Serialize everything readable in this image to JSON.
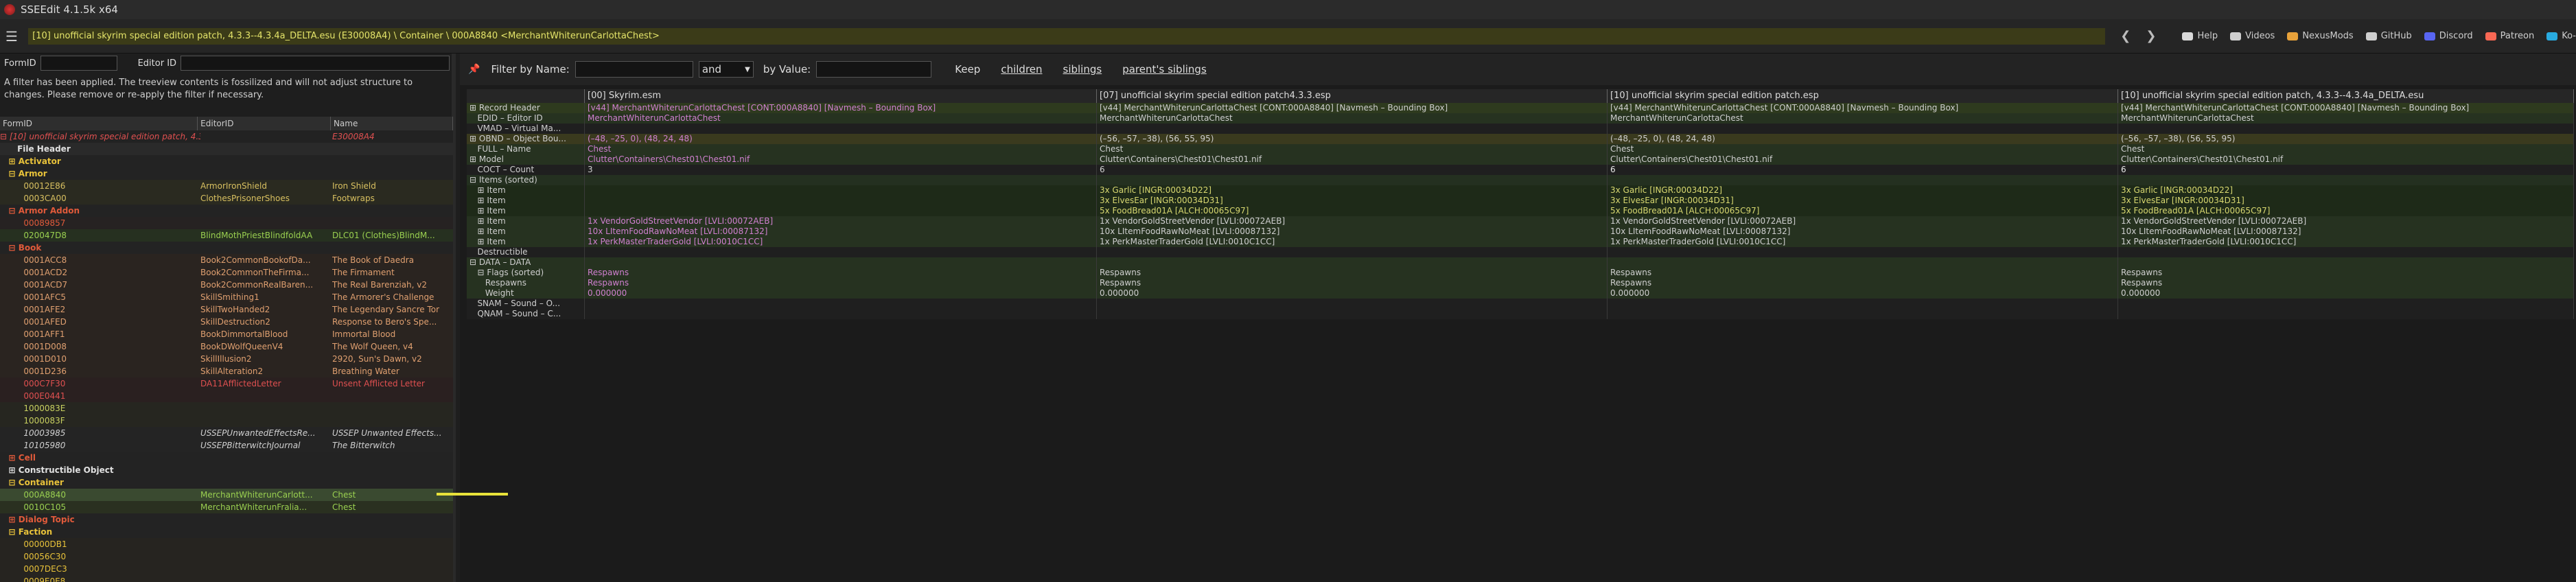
{
  "titlebar": {
    "title": "SSEEdit 4.1.5k x64"
  },
  "navbar": {
    "path": "[10] unofficial skyrim special edition patch, 4.3.3--4.3.4a_DELTA.esu (E30008A4) \\ Container \\ 000A8840 <MerchantWhiterunCarlottaChest>",
    "back": "❮",
    "forward": "❯",
    "links": [
      {
        "label": "Help",
        "color": "#d9d9d9"
      },
      {
        "label": "Videos",
        "color": "#cfcfcf"
      },
      {
        "label": "NexusMods",
        "color": "#e8a23a"
      },
      {
        "label": "GitHub",
        "color": "#cfcfcf"
      },
      {
        "label": "Discord",
        "color": "#5865f2"
      },
      {
        "label": "Patreon",
        "color": "#f96854"
      },
      {
        "label": "Ko-",
        "color": "#29abe0"
      }
    ]
  },
  "left": {
    "formid_label": "FormID",
    "editorid_label": "Editor ID",
    "filter_message": "A filter has been applied. The treeview contents is fossilized and will not adjust structure to changes.  Please remove or re-apply the filter if necessary.",
    "columns": [
      "FormID",
      "EditorID",
      "Name"
    ],
    "tree": [
      {
        "c1": "⊟ [10] unofficial skyrim special edition patch, 4.3.3--4.3.4a_DEL...",
        "c2": "",
        "c3": "E30008A4",
        "color": "#e05050",
        "italic": true,
        "bg": "#222222"
      },
      {
        "c1": "      File Header",
        "c2": "",
        "c3": "",
        "color": "#e0e0e0",
        "bold": true,
        "bg": "#2a2a2a"
      },
      {
        "c1": "   ⊞ Activator",
        "c2": "",
        "c3": "",
        "color": "#e8c23a",
        "bold": true,
        "bg": "#232323"
      },
      {
        "c1": "   ⊟ Armor",
        "c2": "",
        "c3": "",
        "color": "#e8c23a",
        "bold": true,
        "bg": "#232323"
      },
      {
        "c1": "         00012E86",
        "c2": "ArmorIronShield",
        "c3": "Iron Shield",
        "color": "#d8c060",
        "bg": "#2a2a20"
      },
      {
        "c1": "         0003CA00",
        "c2": "ClothesPrisonerShoes",
        "c3": "Footwraps",
        "color": "#d8c060",
        "bg": "#2a2a20"
      },
      {
        "c1": "   ⊟ Armor Addon",
        "c2": "",
        "c3": "",
        "color": "#e05a3a",
        "bold": true,
        "bg": "#232323"
      },
      {
        "c1": "         00089857",
        "c2": "",
        "c3": "",
        "color": "#e05a3a",
        "bg": "#262222"
      },
      {
        "c1": "         020047D8",
        "c2": "BlindMothPriestBlindfoldAA",
        "c3": "DLC01 (Clothes)BlindM...",
        "color": "#9ad050",
        "bg": "#263020"
      },
      {
        "c1": "   ⊟ Book",
        "c2": "",
        "c3": "",
        "color": "#e05a3a",
        "bold": true,
        "bg": "#232323"
      },
      {
        "c1": "         0001ACC8",
        "c2": "Book2CommonBookofDa...",
        "c3": "The Book of Daedra",
        "color": "#e0a070",
        "bg": "#2a2420"
      },
      {
        "c1": "         0001ACD2",
        "c2": "Book2CommonTheFirma...",
        "c3": "The Firmament",
        "color": "#e0a070",
        "bg": "#2a2420"
      },
      {
        "c1": "         0001ACD7",
        "c2": "Book2CommonRealBaren...",
        "c3": "The Real Barenziah, v2",
        "color": "#e0a070",
        "bg": "#2a2420"
      },
      {
        "c1": "         0001AFC5",
        "c2": "SkillSmithing1",
        "c3": "The Armorer's Challenge",
        "color": "#e0a070",
        "bg": "#2a2420"
      },
      {
        "c1": "         0001AFE2",
        "c2": "SkillTwoHanded2",
        "c3": "The Legendary Sancre Tor",
        "color": "#e0a070",
        "bg": "#2a2420"
      },
      {
        "c1": "         0001AFED",
        "c2": "SkillDestruction2",
        "c3": "Response to Bero's Spe...",
        "color": "#e0a070",
        "bg": "#2a2420"
      },
      {
        "c1": "         0001AFF1",
        "c2": "BookDimmortalBlood",
        "c3": "Immortal Blood",
        "color": "#e0a070",
        "bg": "#2a2420"
      },
      {
        "c1": "         0001D008",
        "c2": "BookDWolfQueenV4",
        "c3": "The Wolf Queen, v4",
        "color": "#e0a070",
        "bg": "#2a2420"
      },
      {
        "c1": "         0001D010",
        "c2": "SkillIllusion2",
        "c3": "2920, Sun's Dawn, v2",
        "color": "#e0a070",
        "bg": "#2a2420"
      },
      {
        "c1": "         0001D236",
        "c2": "SkillAlteration2",
        "c3": "Breathing Water",
        "color": "#e0a070",
        "bg": "#2a2420"
      },
      {
        "c1": "         000C7F30",
        "c2": "DA11AfflictedLetter",
        "c3": "Unsent Afflicted Letter",
        "color": "#e05050",
        "bg": "#2a2020"
      },
      {
        "c1": "         000E0441",
        "c2": "",
        "c3": "",
        "color": "#e05050",
        "bg": "#2a2020"
      },
      {
        "c1": "         1000083E",
        "c2": "",
        "c3": "",
        "color": "#c8d060",
        "bg": "#262620"
      },
      {
        "c1": "         1000083F",
        "c2": "",
        "c3": "",
        "color": "#c8d060",
        "bg": "#262620"
      },
      {
        "c1": "         10003985",
        "c2": "USSEPUnwantedEffectsRe...",
        "c3": "USSEP Unwanted Effects...",
        "color": "#d0d0d0",
        "italic": true,
        "bg": "#242424"
      },
      {
        "c1": "         10105980",
        "c2": "USSEPBitterwitchJournal",
        "c3": "The Bitterwitch",
        "color": "#d0d0d0",
        "italic": true,
        "bg": "#242424"
      },
      {
        "c1": "   ⊞ Cell",
        "c2": "",
        "c3": "",
        "color": "#e05a3a",
        "bold": true,
        "bg": "#232323"
      },
      {
        "c1": "   ⊞ Constructible Object",
        "c2": "",
        "c3": "",
        "color": "#e0e0e0",
        "bold": true,
        "bg": "#232323"
      },
      {
        "c1": "   ⊟ Container",
        "c2": "",
        "c3": "",
        "color": "#e8c23a",
        "bold": true,
        "bg": "#232323"
      },
      {
        "c1": "         000A8840",
        "c2": "MerchantWhiterunCarlott...",
        "c3": "Chest",
        "color": "#9ad050",
        "bg": "#3a4a30"
      },
      {
        "c1": "         0010C105",
        "c2": "MerchantWhiterunFralia...",
        "c3": "Chest",
        "color": "#9ad050",
        "bg": "#2a3020"
      },
      {
        "c1": "   ⊞ Dialog Topic",
        "c2": "",
        "c3": "",
        "color": "#e05a3a",
        "bold": true,
        "bg": "#232323"
      },
      {
        "c1": "   ⊟ Faction",
        "c2": "",
        "c3": "",
        "color": "#e8c23a",
        "bold": true,
        "bg": "#232323"
      },
      {
        "c1": "         00000DB1",
        "c2": "",
        "c3": "",
        "color": "#e8c23a",
        "bg": "#262420"
      },
      {
        "c1": "         00056C30",
        "c2": "",
        "c3": "",
        "color": "#e8c23a",
        "bg": "#262420"
      },
      {
        "c1": "         0007DEC3",
        "c2": "",
        "c3": "",
        "color": "#e8c23a",
        "bg": "#262420"
      },
      {
        "c1": "         0009E0E8",
        "c2": "",
        "c3": "",
        "color": "#e8c23a",
        "bg": "#262420"
      }
    ]
  },
  "right": {
    "filter_by_name": "Filter by Name:",
    "and_label": "and",
    "by_value": "by Value:",
    "keep": "Keep",
    "children": "children",
    "siblings": "siblings",
    "parents_siblings": "parent's siblings",
    "headers": [
      "",
      "[00] Skyrim.esm",
      "[07] unofficial skyrim special edition patch4.3.3.esp",
      "[10] unofficial skyrim special edition patch.esp",
      "[10] unofficial skyrim special edition patch, 4.3.3--4.3.4a_DELTA.esu"
    ],
    "rows": [
      {
        "cells": [
          "⊞ Record Header",
          "[v44] MerchantWhiterunCarlottaChest [CONT:000A8840] [Navmesh – Bounding Box]",
          "[v44] MerchantWhiterunCarlottaChest [CONT:000A8840] [Navmesh – Bounding Box]",
          "[v44] MerchantWhiterunCarlottaChest [CONT:000A8840] [Navmesh – Bounding Box]",
          "[v44] MerchantWhiterunCarlottaChest [CONT:000A8840] [Navmesh – Bounding Box]"
        ],
        "bg": "#2e3a1e",
        "colors": [
          "#cfcfcf",
          "#d080d0",
          "#cfcfcf",
          "#cfcfcf",
          "#cfcfcf"
        ]
      },
      {
        "cells": [
          "   EDID – Editor ID",
          "MerchantWhiterunCarlottaChest",
          "MerchantWhiterunCarlottaChest",
          "MerchantWhiterunCarlottaChest",
          "MerchantWhiterunCarlottaChest"
        ],
        "bg": "#263220",
        "colors": [
          "#cfcfcf",
          "#d080d0",
          "#cfcfcf",
          "#cfcfcf",
          "#cfcfcf"
        ]
      },
      {
        "cells": [
          "   VMAD – Virtual Ma...",
          "",
          "",
          "",
          ""
        ],
        "bg": "#1f1f1f",
        "colors": [
          "#cfcfcf",
          "#cfcfcf",
          "#cfcfcf",
          "#cfcfcf",
          "#cfcfcf"
        ]
      },
      {
        "cells": [
          "⊞ OBND – Object Bou...",
          "(–48, –25, 0), (48, 24, 48)",
          "(–56, –57, –38), (56, 55, 95)",
          "(–48, –25, 0), (48, 24, 48)",
          "(–56, –57, –38), (56, 55, 95)"
        ],
        "bg": "#3a3a1e",
        "colors": [
          "#cfcfcf",
          "#d080d0",
          "#cfcfcf",
          "#cfcfcf",
          "#cfcfcf"
        ]
      },
      {
        "cells": [
          "   FULL – Name",
          "Chest",
          "Chest",
          "Chest",
          "Chest"
        ],
        "bg": "#263220",
        "colors": [
          "#cfcfcf",
          "#d080d0",
          "#cfcfcf",
          "#cfcfcf",
          "#cfcfcf"
        ]
      },
      {
        "cells": [
          "⊞ Model",
          "Clutter\\Containers\\Chest01\\Chest01.nif",
          "Clutter\\Containers\\Chest01\\Chest01.nif",
          "Clutter\\Containers\\Chest01\\Chest01.nif",
          "Clutter\\Containers\\Chest01\\Chest01.nif"
        ],
        "bg": "#263220",
        "colors": [
          "#cfcfcf",
          "#d080d0",
          "#cfcfcf",
          "#cfcfcf",
          "#cfcfcf"
        ]
      },
      {
        "cells": [
          "   COCT – Count",
          "3",
          "6",
          "6",
          "6"
        ],
        "bg": "#1f1f1f",
        "colors": [
          "#cfcfcf",
          "#cfcfcf",
          "#cfcfcf",
          "#e8e8e8",
          "#e8e8e8"
        ]
      },
      {
        "cells": [
          "⊟ Items (sorted)",
          "",
          "",
          "",
          ""
        ],
        "bg": "#243020",
        "colors": [
          "#cfcfcf",
          "#cfcfcf",
          "#cfcfcf",
          "#cfcfcf",
          "#cfcfcf"
        ]
      },
      {
        "cells": [
          "   ⊞ Item",
          "",
          "3x Garlic [INGR:00034D22]",
          "3x Garlic [INGR:00034D22]",
          "3x Garlic [INGR:00034D22]"
        ],
        "bg": "#1e2a18",
        "colors": [
          "#cfcfcf",
          "#cfcfcf",
          "#d8d870",
          "#d8d870",
          "#d8d870"
        ]
      },
      {
        "cells": [
          "   ⊞ Item",
          "",
          "3x ElvesEar [INGR:00034D31]",
          "3x ElvesEar [INGR:00034D31]",
          "3x ElvesEar [INGR:00034D31]"
        ],
        "bg": "#1e2a18",
        "colors": [
          "#cfcfcf",
          "#cfcfcf",
          "#d8d870",
          "#d8d870",
          "#d8d870"
        ]
      },
      {
        "cells": [
          "   ⊞ Item",
          "",
          "5x FoodBread01A [ALCH:00065C97]",
          "5x FoodBread01A [ALCH:00065C97]",
          "5x FoodBread01A [ALCH:00065C97]"
        ],
        "bg": "#1e2a18",
        "colors": [
          "#cfcfcf",
          "#cfcfcf",
          "#d8d870",
          "#d8d870",
          "#d8d870"
        ]
      },
      {
        "cells": [
          "   ⊞ Item",
          "1x VendorGoldStreetVendor [LVLI:00072AEB]",
          "1x VendorGoldStreetVendor [LVLI:00072AEB]",
          "1x VendorGoldStreetVendor [LVLI:00072AEB]",
          "1x VendorGoldStreetVendor [LVLI:00072AEB]"
        ],
        "bg": "#263220",
        "colors": [
          "#cfcfcf",
          "#d080d0",
          "#cfcfcf",
          "#cfcfcf",
          "#cfcfcf"
        ]
      },
      {
        "cells": [
          "   ⊞ Item",
          "10x LItemFoodRawNoMeat [LVLI:00087132]",
          "10x LItemFoodRawNoMeat [LVLI:00087132]",
          "10x LItemFoodRawNoMeat [LVLI:00087132]",
          "10x LItemFoodRawNoMeat [LVLI:00087132]"
        ],
        "bg": "#263220",
        "colors": [
          "#cfcfcf",
          "#d080d0",
          "#cfcfcf",
          "#cfcfcf",
          "#cfcfcf"
        ]
      },
      {
        "cells": [
          "   ⊞ Item",
          "1x PerkMasterTraderGold [LVLI:0010C1CC]",
          "1x PerkMasterTraderGold [LVLI:0010C1CC]",
          "1x PerkMasterTraderGold [LVLI:0010C1CC]",
          "1x PerkMasterTraderGold [LVLI:0010C1CC]"
        ],
        "bg": "#263220",
        "colors": [
          "#cfcfcf",
          "#d080d0",
          "#cfcfcf",
          "#cfcfcf",
          "#cfcfcf"
        ]
      },
      {
        "cells": [
          "   Destructible",
          "",
          "",
          "",
          ""
        ],
        "bg": "#1f1f1f",
        "colors": [
          "#cfcfcf",
          "#cfcfcf",
          "#cfcfcf",
          "#cfcfcf",
          "#cfcfcf"
        ]
      },
      {
        "cells": [
          "⊟ DATA – DATA",
          "",
          "",
          "",
          ""
        ],
        "bg": "#263220",
        "colors": [
          "#cfcfcf",
          "#cfcfcf",
          "#cfcfcf",
          "#cfcfcf",
          "#cfcfcf"
        ]
      },
      {
        "cells": [
          "   ⊟ Flags (sorted)",
          "Respawns",
          "Respawns",
          "Respawns",
          "Respawns"
        ],
        "bg": "#263220",
        "colors": [
          "#cfcfcf",
          "#d080d0",
          "#cfcfcf",
          "#cfcfcf",
          "#cfcfcf"
        ]
      },
      {
        "cells": [
          "      Respawns",
          "Respawns",
          "Respawns",
          "Respawns",
          "Respawns"
        ],
        "bg": "#263220",
        "colors": [
          "#cfcfcf",
          "#d080d0",
          "#cfcfcf",
          "#cfcfcf",
          "#cfcfcf"
        ]
      },
      {
        "cells": [
          "      Weight",
          "0.000000",
          "0.000000",
          "0.000000",
          "0.000000"
        ],
        "bg": "#263220",
        "colors": [
          "#cfcfcf",
          "#d080d0",
          "#cfcfcf",
          "#cfcfcf",
          "#cfcfcf"
        ]
      },
      {
        "cells": [
          "   SNAM – Sound – O...",
          "",
          "",
          "",
          ""
        ],
        "bg": "#1f1f1f",
        "colors": [
          "#cfcfcf",
          "#cfcfcf",
          "#cfcfcf",
          "#cfcfcf",
          "#cfcfcf"
        ]
      },
      {
        "cells": [
          "   QNAM – Sound – C...",
          "",
          "",
          "",
          ""
        ],
        "bg": "#1f1f1f",
        "colors": [
          "#cfcfcf",
          "#cfcfcf",
          "#cfcfcf",
          "#cfcfcf",
          "#cfcfcf"
        ]
      }
    ]
  }
}
